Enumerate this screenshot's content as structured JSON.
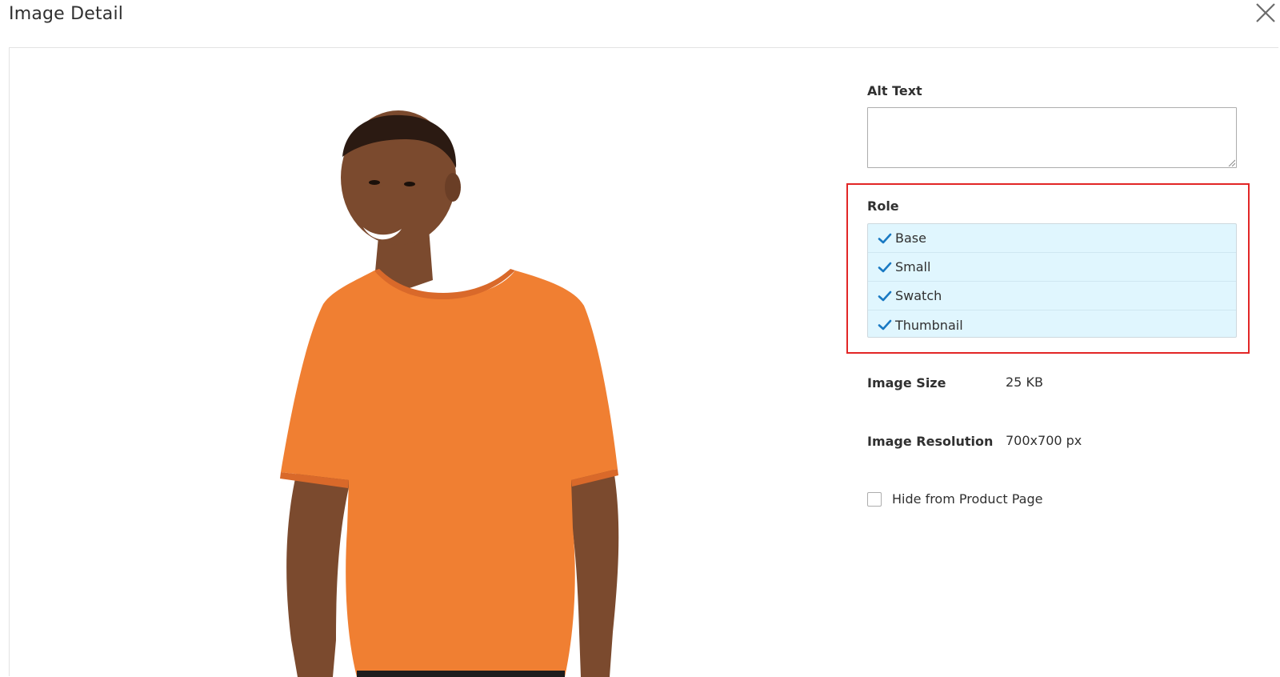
{
  "header": {
    "title": "Image Detail",
    "close_icon": "close-icon"
  },
  "preview": {
    "subject": "product-photo-orange-tshirt",
    "shirt_color": "#f07f32",
    "skin_color": "#7b4a2e"
  },
  "alt_text": {
    "label": "Alt Text",
    "value": ""
  },
  "role": {
    "label": "Role",
    "highlight_color": "#e22626",
    "items": [
      {
        "label": "Base",
        "checked": true
      },
      {
        "label": "Small",
        "checked": true
      },
      {
        "label": "Swatch",
        "checked": true
      },
      {
        "label": "Thumbnail",
        "checked": true
      }
    ]
  },
  "info": {
    "size_label": "Image Size",
    "size_value": "25 KB",
    "resolution_label": "Image Resolution",
    "resolution_value": "700x700 px"
  },
  "hide": {
    "label": "Hide from Product Page",
    "checked": false
  },
  "colors": {
    "role_bg": "#e0f6fe",
    "check_blue": "#1979c3"
  }
}
